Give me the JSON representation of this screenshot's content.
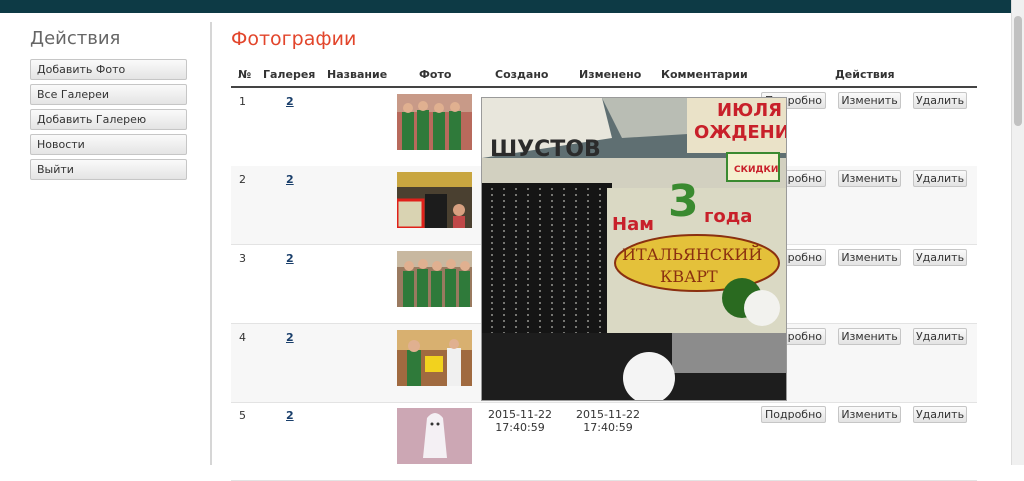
{
  "sidebar": {
    "title": "Действия",
    "items": [
      {
        "label": "Добавить Фото"
      },
      {
        "label": "Все Галереи"
      },
      {
        "label": "Добавить Галерею"
      },
      {
        "label": "Новости"
      },
      {
        "label": "Выйти"
      }
    ]
  },
  "main": {
    "title": "Фотографии",
    "headers": {
      "num": "№",
      "gallery": "Галерея",
      "name": "Название",
      "photo": "Фото",
      "created": "Создано",
      "modified": "Изменено",
      "comments": "Комментарии",
      "actions": "Действия"
    },
    "buttons": {
      "details": "Подробно",
      "edit": "Изменить",
      "delete": "Удалить"
    },
    "rows": [
      {
        "num": "1",
        "gallery": "2",
        "created_date": "",
        "created_time": "",
        "modified_date": "",
        "modified_time": ""
      },
      {
        "num": "2",
        "gallery": "2",
        "created_date": "",
        "created_time": "",
        "modified_date": "",
        "modified_time": ""
      },
      {
        "num": "3",
        "gallery": "2",
        "created_date": "",
        "created_time": "",
        "modified_date": "",
        "modified_time": ""
      },
      {
        "num": "4",
        "gallery": "2",
        "created_date": "",
        "created_time": "",
        "modified_date": "",
        "modified_time": ""
      },
      {
        "num": "5",
        "gallery": "2",
        "created_date": "2015-11-22",
        "created_time": "17:40:59",
        "modified_date": "2015-11-22",
        "modified_time": "17:40:59"
      }
    ]
  },
  "preview": {
    "sign_line1": "ШУСТОВ",
    "sign_line2": "Нам",
    "sign_number": "3",
    "sign_line3": "года",
    "sign_line4": "ИТАЛЬЯНСКИЙ",
    "sign_line5": "КВАРТ",
    "sign_line6": "ИЮЛЯ",
    "sign_line7": "ОЖДЕНИ",
    "sign_line8": "СКИДКИ"
  },
  "colors": {
    "topbar": "#0d3a45",
    "title": "#e2452b",
    "link": "#1a3f6b"
  }
}
